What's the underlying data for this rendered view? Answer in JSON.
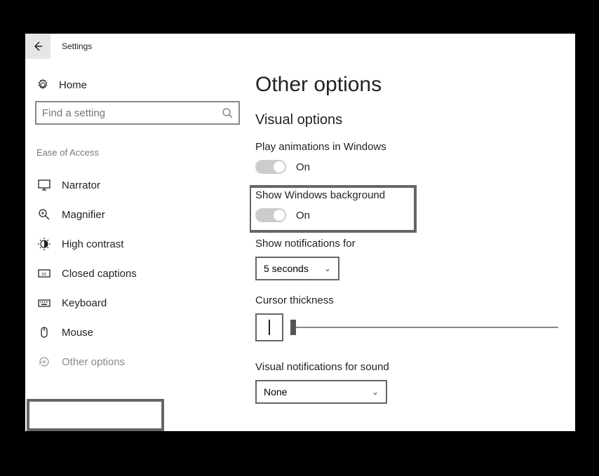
{
  "titlebar": {
    "app_title": "Settings"
  },
  "sidebar": {
    "home_label": "Home",
    "search_placeholder": "Find a setting",
    "section_label": "Ease of Access",
    "items": [
      {
        "label": "Narrator"
      },
      {
        "label": "Magnifier"
      },
      {
        "label": "High contrast"
      },
      {
        "label": "Closed captions"
      },
      {
        "label": "Keyboard"
      },
      {
        "label": "Mouse"
      },
      {
        "label": "Other options"
      }
    ]
  },
  "content": {
    "page_title": "Other options",
    "subheading": "Visual options",
    "play_animations": {
      "label": "Play animations in Windows",
      "state": "On"
    },
    "show_background": {
      "label": "Show Windows background",
      "state": "On"
    },
    "notifications": {
      "label": "Show notifications for",
      "value": "5 seconds"
    },
    "cursor_thickness": {
      "label": "Cursor thickness"
    },
    "visual_notifications": {
      "label": "Visual notifications for sound",
      "value": "None"
    }
  }
}
